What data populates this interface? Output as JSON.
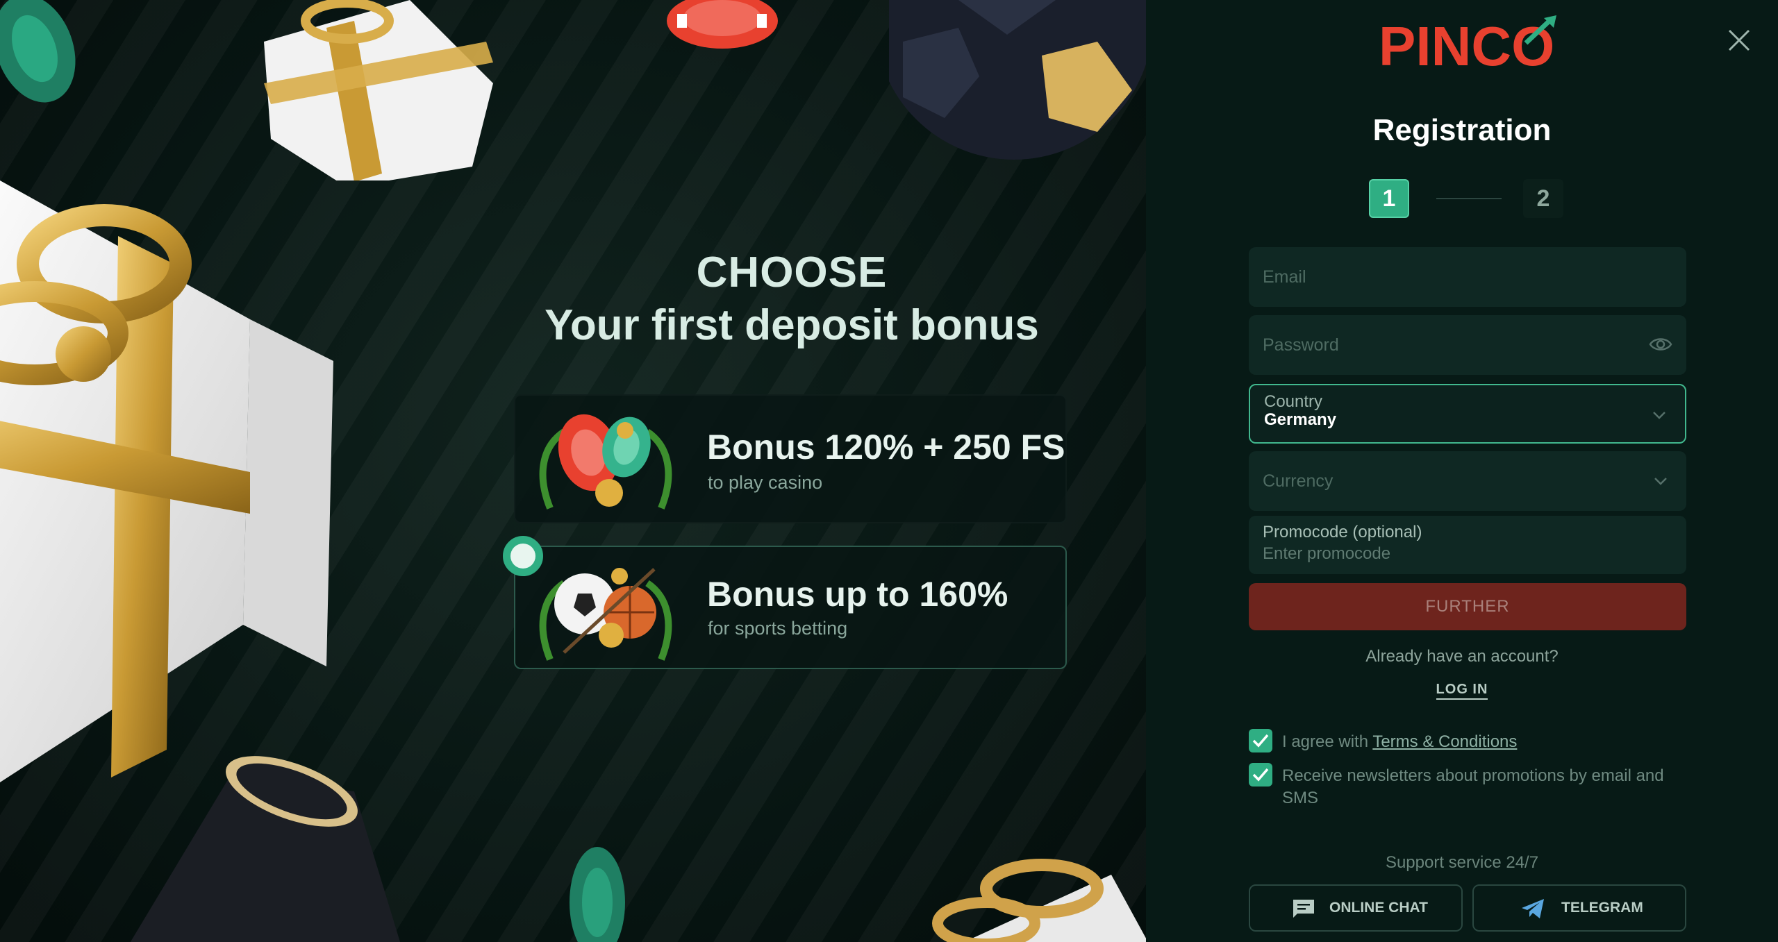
{
  "promo": {
    "title_line1": "CHOOSE",
    "title_line2": "Your first deposit bonus",
    "bonuses": [
      {
        "title": "Bonus 120% + 250 FS",
        "subtitle": "to play casino",
        "selected": false
      },
      {
        "title": "Bonus up to 160%",
        "subtitle": "for sports betting",
        "selected": true
      }
    ]
  },
  "registration": {
    "logo_text": "PINCO",
    "title": "Registration",
    "steps": [
      "1",
      "2"
    ],
    "current_step": 1,
    "email_placeholder": "Email",
    "password_placeholder": "Password",
    "country_label": "Country",
    "country_value": "Germany",
    "currency_placeholder": "Currency",
    "promocode_label": "Promocode (optional)",
    "promocode_placeholder": "Enter promocode",
    "further_label": "FURTHER",
    "have_account": "Already have an account?",
    "login_label": "LOG IN",
    "agree_prefix": "I agree with ",
    "terms_link": "Terms & Conditions",
    "newsletter_text": "Receive newsletters about promotions by email and SMS",
    "agree_checked": true,
    "newsletter_checked": true,
    "support_text": "Support service 24/7",
    "online_chat_label": "ONLINE CHAT",
    "telegram_label": "TELEGRAM"
  },
  "colors": {
    "accent_green": "#2fae83",
    "brand_red": "#e8412f",
    "button_disabled_red": "#6e241d",
    "panel_bg": "#071a16"
  },
  "icons": [
    "close-icon",
    "eye-icon",
    "chevron-down-icon",
    "check-icon",
    "chat-icon",
    "telegram-icon"
  ]
}
